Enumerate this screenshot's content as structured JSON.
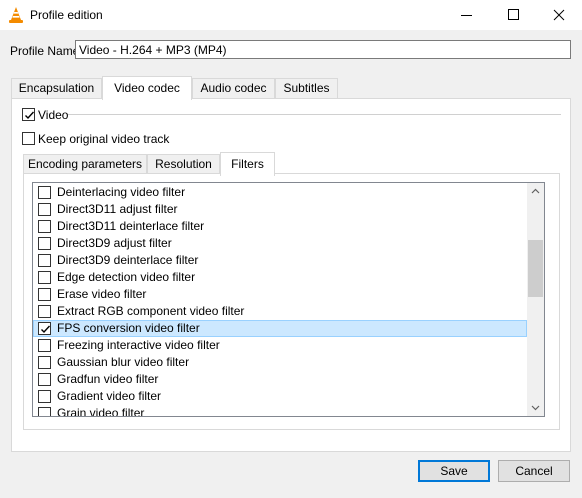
{
  "window": {
    "title": "Profile edition",
    "icon": "vlc-cone-icon",
    "controls": [
      "minimize-icon",
      "maximize-icon",
      "close-icon"
    ]
  },
  "profile": {
    "label": "Profile Name",
    "value": "Video - H.264 + MP3 (MP4)"
  },
  "tabs": {
    "items": [
      "Encapsulation",
      "Video codec",
      "Audio codec",
      "Subtitles"
    ],
    "active": "Video codec"
  },
  "video": {
    "video_label": "Video",
    "video_checked": true,
    "keep_label": "Keep original video track",
    "keep_checked": false
  },
  "subtabs": {
    "items": [
      "Encoding parameters",
      "Resolution",
      "Filters"
    ],
    "active": "Filters"
  },
  "filters": {
    "items": [
      {
        "label": "Deinterlacing video filter",
        "checked": false
      },
      {
        "label": "Direct3D11 adjust filter",
        "checked": false
      },
      {
        "label": "Direct3D11 deinterlace filter",
        "checked": false
      },
      {
        "label": "Direct3D9 adjust filter",
        "checked": false
      },
      {
        "label": "Direct3D9 deinterlace filter",
        "checked": false
      },
      {
        "label": "Edge detection video filter",
        "checked": false
      },
      {
        "label": "Erase video filter",
        "checked": false
      },
      {
        "label": "Extract RGB component video filter",
        "checked": false
      },
      {
        "label": "FPS conversion video filter",
        "checked": true,
        "selected": true
      },
      {
        "label": "Freezing interactive video filter",
        "checked": false
      },
      {
        "label": "Gaussian blur video filter",
        "checked": false
      },
      {
        "label": "Gradfun video filter",
        "checked": false
      },
      {
        "label": "Gradient video filter",
        "checked": false
      },
      {
        "label": "Grain video filter",
        "checked": false
      }
    ]
  },
  "buttons": {
    "save": "Save",
    "cancel": "Cancel"
  },
  "colors": {
    "selection_bg": "#cce8ff",
    "selection_border": "#99d1ff",
    "default_button_border": "#0078d7"
  }
}
